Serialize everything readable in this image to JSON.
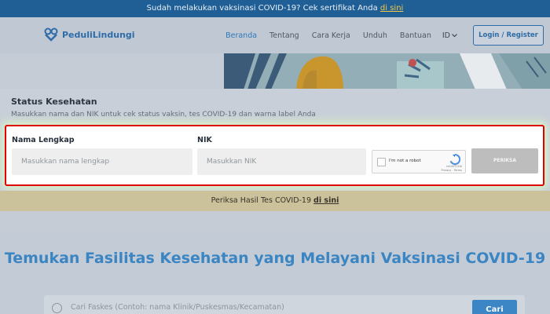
{
  "topbar": {
    "text": "Sudah melakukan vaksinasi COVID-19? Cek sertifikat Anda ",
    "link": "di sini"
  },
  "nav": {
    "logo": "PeduliLindungi",
    "items": [
      "Beranda",
      "Tentang",
      "Cara Kerja",
      "Unduh",
      "Bantuan"
    ],
    "lang": "ID",
    "login": "Login / Register"
  },
  "status": {
    "title": "Status Kesehatan",
    "subtitle": "Masukkan nama dan NIK untuk cek status vaksin, tes COVID-19 dan warna label Anda",
    "name_label": "Nama Lengkap",
    "name_placeholder": "Masukkan nama lengkap",
    "nik_label": "NIK",
    "nik_placeholder": "Masukkan NIK",
    "captcha_text": "I'm not a robot",
    "captcha_brand": "reCAPTCHA",
    "captcha_links": "Privacy - Terms",
    "check_button": "PERIKSA"
  },
  "test": {
    "text": "Periksa Hasil Tes COVID-19 ",
    "link": "di sini"
  },
  "facility": {
    "title": "Temukan Fasilitas Kesehatan yang Melayani Vaksinasi COVID-19",
    "search_placeholder": "Cari Faskes (Contoh: nama Klinik/Puskesmas/Kecamatan)",
    "search_button": "Cari"
  },
  "colors": {
    "brand": "#2f78b9",
    "highlight_border": "#e00000",
    "link_yellow": "#f2c84a"
  }
}
